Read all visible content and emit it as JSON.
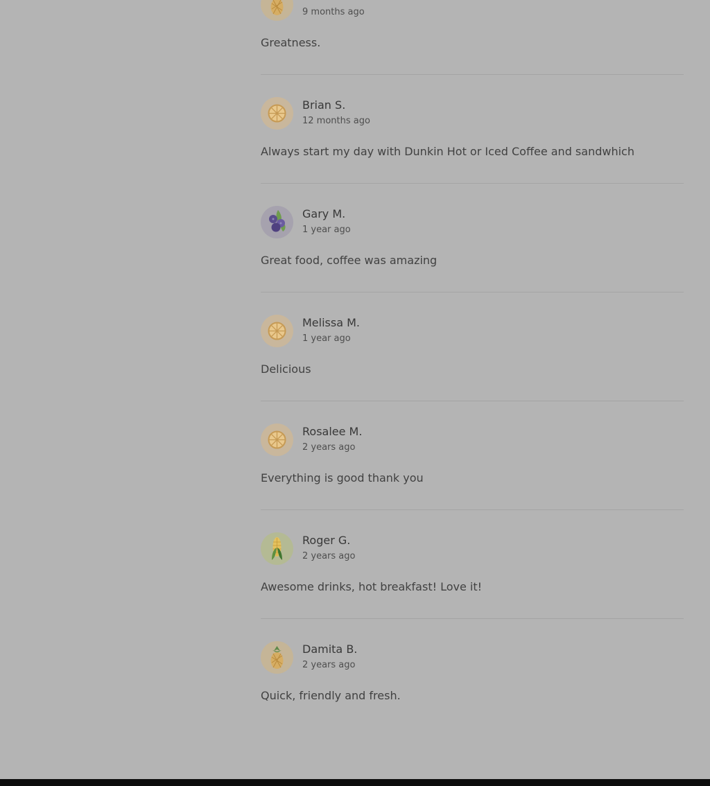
{
  "reviews": [
    {
      "name": "",
      "time": "9 months ago",
      "text": "Greatness.",
      "avatar": "pineapple-avatar-icon"
    },
    {
      "name": "Brian S.",
      "time": "12 months ago",
      "text": "Always start my day with Dunkin Hot or Iced Coffee and sandwhich",
      "avatar": "orange-slice-avatar-icon"
    },
    {
      "name": "Gary M.",
      "time": "1 year ago",
      "text": "Great food, coffee was amazing",
      "avatar": "blueberry-avatar-icon"
    },
    {
      "name": "Melissa M.",
      "time": "1 year ago",
      "text": "Delicious",
      "avatar": "orange-slice-avatar-icon"
    },
    {
      "name": "Rosalee M.",
      "time": "2 years ago",
      "text": "Everything is good thank you",
      "avatar": "orange-slice-avatar-icon"
    },
    {
      "name": "Roger G.",
      "time": "2 years ago",
      "text": "Awesome drinks, hot breakfast! Love it!",
      "avatar": "corn-avatar-icon"
    },
    {
      "name": "Damita B.",
      "time": "2 years ago",
      "text": "Quick, friendly and fresh.",
      "avatar": "pineapple-avatar-icon"
    }
  ],
  "colors": {
    "overlay_background": "#b4b4b4",
    "divider": "#a4a4a4",
    "footer": "#0c0c0c"
  }
}
